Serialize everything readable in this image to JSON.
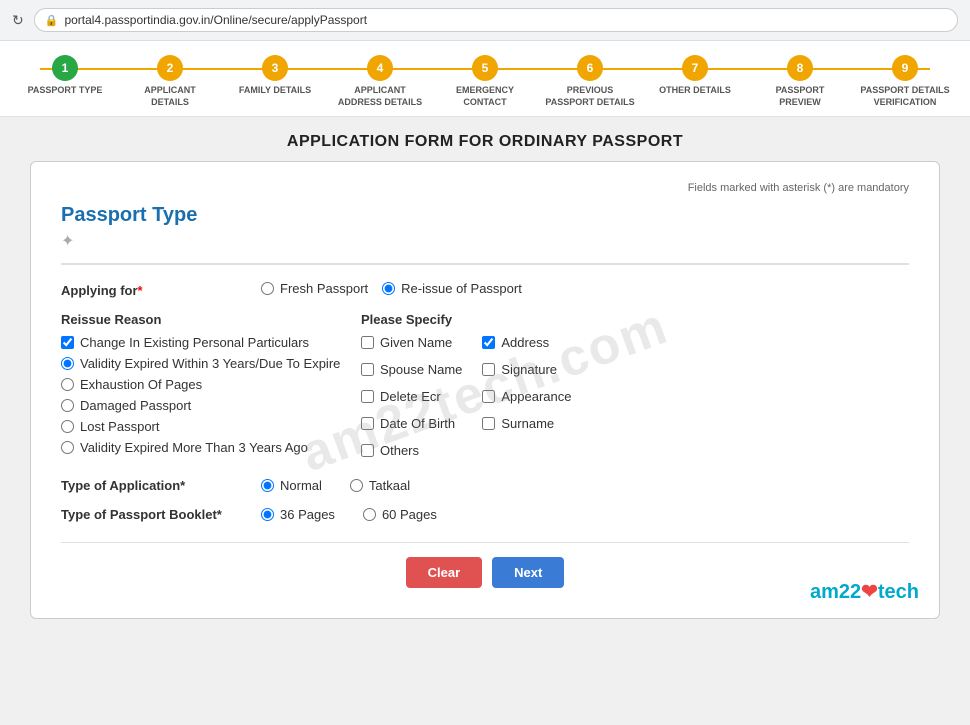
{
  "browser": {
    "url": "portal4.passportindia.gov.in/Online/secure/applyPassport"
  },
  "steps": [
    {
      "number": "1",
      "label": "PASSPORT TYPE",
      "status": "active"
    },
    {
      "number": "2",
      "label": "APPLICANT DETAILS",
      "status": "pending"
    },
    {
      "number": "3",
      "label": "FAMILY DETAILS",
      "status": "pending"
    },
    {
      "number": "4",
      "label": "APPLICANT ADDRESS DETAILS",
      "status": "pending"
    },
    {
      "number": "5",
      "label": "EMERGENCY CONTACT",
      "status": "pending"
    },
    {
      "number": "6",
      "label": "PREVIOUS PASSPORT DETAILS",
      "status": "pending"
    },
    {
      "number": "7",
      "label": "OTHER DETAILS",
      "status": "pending"
    },
    {
      "number": "8",
      "label": "PASSPORT PREVIEW",
      "status": "pending"
    },
    {
      "number": "9",
      "label": "PASSPORT DETAILS VERIFICATION",
      "status": "pending"
    }
  ],
  "page": {
    "title": "APPLICATION FORM FOR ORDINARY PASSPORT",
    "mandatory_note": "Fields marked with asterisk (*) are mandatory"
  },
  "form": {
    "section_title": "Passport Type",
    "applying_for_label": "Applying for",
    "applying_for_options": [
      {
        "id": "fresh",
        "label": "Fresh Passport",
        "checked": false
      },
      {
        "id": "reissue",
        "label": "Re-issue of Passport",
        "checked": true
      }
    ],
    "reissue_reason_title": "Reissue Reason",
    "reissue_reasons": [
      {
        "id": "change_particulars",
        "label": "Change In Existing Personal Particulars",
        "checked": true,
        "type": "checkbox"
      },
      {
        "id": "validity_3yrs",
        "label": "Validity Expired Within 3 Years/Due To Expire",
        "checked": true,
        "type": "radio"
      },
      {
        "id": "exhaustion",
        "label": "Exhaustion Of Pages",
        "checked": false,
        "type": "radio"
      },
      {
        "id": "damaged",
        "label": "Damaged Passport",
        "checked": false,
        "type": "radio"
      },
      {
        "id": "lost",
        "label": "Lost Passport",
        "checked": false,
        "type": "radio"
      },
      {
        "id": "validity_more",
        "label": "Validity Expired More Than 3 Years Ago",
        "checked": false,
        "type": "radio"
      }
    ],
    "please_specify_title": "Please Specify",
    "specify_col1": [
      {
        "id": "given_name",
        "label": "Given Name",
        "checked": false
      },
      {
        "id": "spouse_name",
        "label": "Spouse Name",
        "checked": false
      },
      {
        "id": "delete_ecr",
        "label": "Delete Ecr",
        "checked": false
      },
      {
        "id": "date_of_birth",
        "label": "Date Of Birth",
        "checked": false
      },
      {
        "id": "others",
        "label": "Others",
        "checked": false
      }
    ],
    "specify_col2": [
      {
        "id": "address",
        "label": "Address",
        "checked": true
      },
      {
        "id": "signature",
        "label": "Signature",
        "checked": false
      },
      {
        "id": "appearance",
        "label": "Appearance",
        "checked": false
      },
      {
        "id": "surname",
        "label": "Surname",
        "checked": false
      }
    ],
    "type_of_application_label": "Type of Application",
    "type_of_application_options": [
      {
        "id": "normal",
        "label": "Normal",
        "checked": true
      },
      {
        "id": "tatkaal",
        "label": "Tatkaal",
        "checked": false
      }
    ],
    "type_of_booklet_label": "Type of Passport Booklet",
    "type_of_booklet_options": [
      {
        "id": "36pages",
        "label": "36 Pages",
        "checked": true
      },
      {
        "id": "60pages",
        "label": "60 Pages",
        "checked": false
      }
    ],
    "clear_button": "Clear",
    "next_button": "Next"
  },
  "watermark": "am22tech.com",
  "branding": {
    "text_left": "am22",
    "text_right": "tech",
    "heart": "❤"
  }
}
